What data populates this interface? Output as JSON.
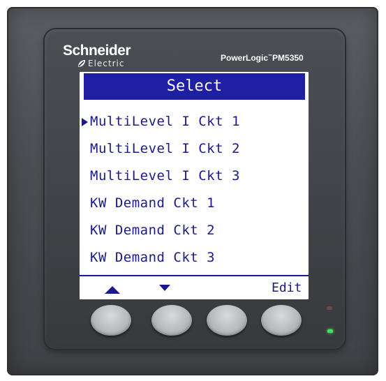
{
  "device": {
    "brand": "Schneider",
    "brand_sub": "Electric",
    "model_name": "PowerLogic",
    "model_tm": "™",
    "model_number": "PM5350"
  },
  "screen": {
    "title": "Select",
    "selected_index": 0,
    "items": [
      {
        "label": "MultiLevel I Ckt 1"
      },
      {
        "label": "MultiLevel I Ckt 2"
      },
      {
        "label": "MultiLevel I Ckt 3"
      },
      {
        "label": "KW Demand Ckt 1"
      },
      {
        "label": "KW Demand Ckt 2"
      },
      {
        "label": "KW Demand Ckt 3"
      }
    ],
    "softkeys": {
      "up": "up-triangle-icon",
      "down": "down-triangle-icon",
      "edit": "Edit"
    }
  },
  "leds": {
    "alarm": {
      "state": "off",
      "color": "#6a4a4a"
    },
    "power": {
      "state": "on",
      "color": "#46e05c"
    }
  },
  "colors": {
    "screen_text": "#1a1a8c",
    "title_bg": "#1f1fa3",
    "housing": "#4a4d51"
  }
}
